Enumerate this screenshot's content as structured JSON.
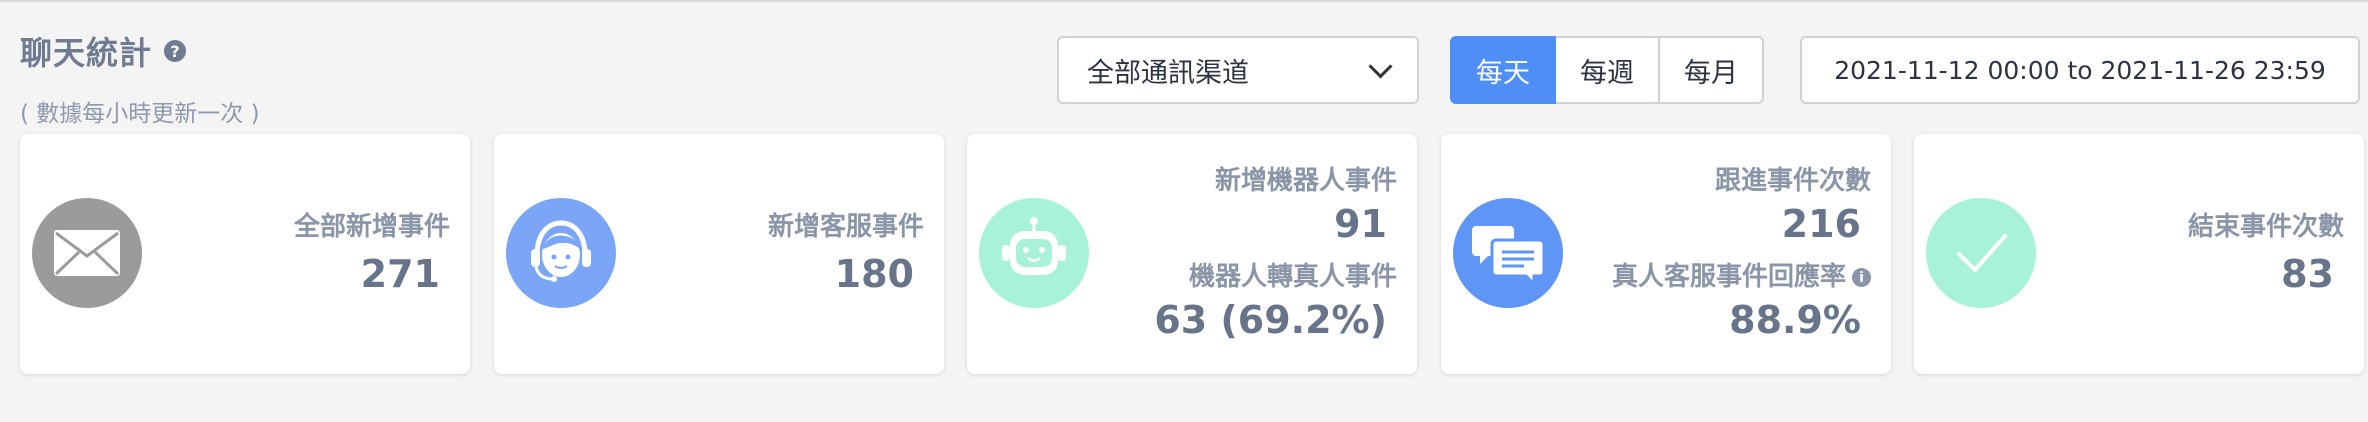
{
  "header": {
    "title": "聊天統計",
    "help_icon": "?",
    "subtitle": "( 數據每小時更新一次 )"
  },
  "filters": {
    "channel_selected": "全部通訊渠道",
    "periods": [
      "每天",
      "每週",
      "每月"
    ],
    "active_period": "每天",
    "date_range": "2021-11-12 00:00 to 2021-11-26 23:59"
  },
  "cards": {
    "all_new": {
      "label": "全部新增事件",
      "value": "271",
      "icon": "envelope-icon",
      "color": "#9b9b9b"
    },
    "agent_new": {
      "label": "新增客服事件",
      "value": "180",
      "icon": "customer-service-agent-icon",
      "color": "#7ba6f7"
    },
    "bot": {
      "label": "新增機器人事件",
      "value": "91",
      "transfer_label": "機器人轉真人事件",
      "transfer_value": "63 (69.2%)",
      "icon": "robot-icon",
      "color": "#a7f2d8"
    },
    "followup": {
      "label": "跟進事件次數",
      "value": "216",
      "rate_label": "真人客服事件回應率",
      "rate_value": "88.9%",
      "info_icon": "i",
      "icon": "chat-bubbles-icon",
      "color": "#5f95f5"
    },
    "closed": {
      "label": "結束事件次數",
      "value": "83",
      "icon": "checkmark-icon",
      "color": "#a7f2d8"
    }
  }
}
